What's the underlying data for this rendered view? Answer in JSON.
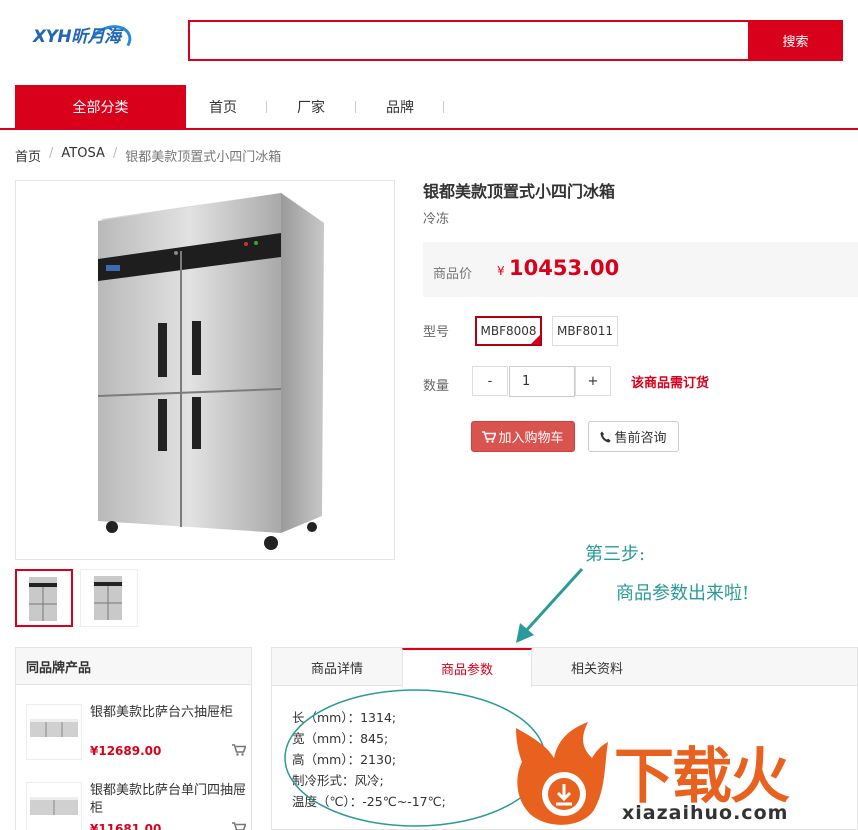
{
  "header": {
    "logo_text": "XYH昕月海",
    "search_placeholder": "",
    "search_button": "搜索"
  },
  "nav": {
    "all_categories": "全部分类",
    "items": [
      "首页",
      "厂家",
      "品牌"
    ]
  },
  "breadcrumb": [
    "首页",
    "ATOSA",
    "银都美款顶置式小四门冰箱"
  ],
  "breadcrumb_sep": "/",
  "product": {
    "title": "银都美款顶置式小四门冰箱",
    "subtitle": "冷冻",
    "price_label": "商品价",
    "currency": "¥",
    "price": "10453.00",
    "model_label": "型号",
    "models": [
      "MBF8008",
      "MBF8011"
    ],
    "selected_model": "MBF8008",
    "qty_label": "数量",
    "qty_minus": "-",
    "qty_value": "1",
    "qty_plus": "+",
    "order_note": "该商品需订货",
    "add_to_cart": "加入购物车",
    "consult": "售前咨询"
  },
  "annotation": {
    "step": "第三步:",
    "text": "商品参数出来啦!"
  },
  "same_brand": {
    "title": "同品牌产品",
    "items": [
      {
        "name": "银都美款比萨台六抽屉柜",
        "price": "¥12689.00"
      },
      {
        "name": "银都美款比萨台单门四抽屉柜",
        "price": "¥11681.00"
      }
    ]
  },
  "tabs": {
    "items": [
      "商品详情",
      "商品参数",
      "相关资料"
    ],
    "active": "商品参数"
  },
  "params": [
    "长（mm）：1314;",
    "宽（mm）：845;",
    "高（mm）：2130;",
    "制冷形式：风冷;",
    "温度（℃）：-25℃~-17℃;"
  ],
  "watermark": {
    "text": "下载火",
    "url": "xiazaihuo.com"
  },
  "colors": {
    "brand_red": "#d9001b",
    "cart_button": "#d9534f",
    "annotation_teal": "#2a9a9a",
    "watermark_orange": "#e8611f"
  }
}
